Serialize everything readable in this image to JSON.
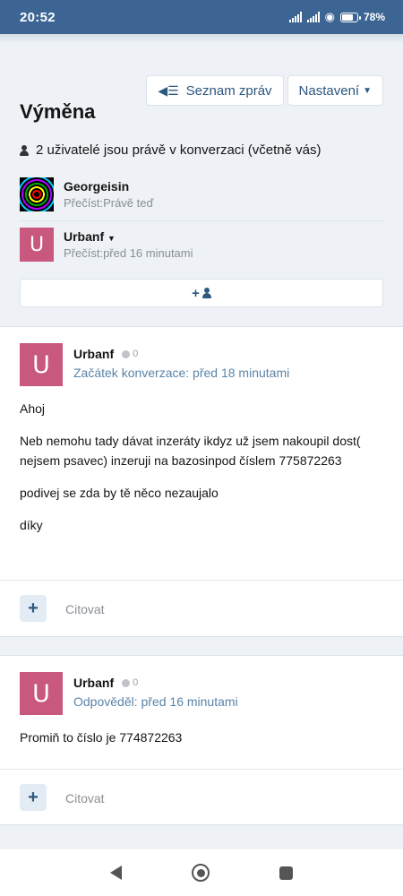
{
  "status_bar": {
    "time": "20:52",
    "battery": "78"
  },
  "toolbar": {
    "message_list": "Seznam zpráv",
    "settings": "Nastavení"
  },
  "page_title": "Výměna",
  "participants": {
    "note": "2 uživatelé jsou právě v konverzaci (včetně vás)",
    "members": [
      {
        "name": "Georgeisin",
        "read_label": "Přečíst:Právě teď"
      },
      {
        "name": "Urbanf",
        "read_label": "Přečíst:před 16 minutami",
        "avatar_letter": "U"
      }
    ]
  },
  "messages": [
    {
      "author": "Urbanf",
      "avatar_letter": "U",
      "count": "0",
      "meta": "Začátek konverzace: před 18 minutami",
      "paragraphs": [
        "Ahoj",
        "Neb nemohu tady dávat inzeráty ikdyz už jsem nakoupil dost( nejsem psavec) inzeruji na bazosinpod číslem 775872263",
        "podivej se zda by tě něco nezaujalo",
        "díky"
      ],
      "quote": "Citovat"
    },
    {
      "author": "Urbanf",
      "avatar_letter": "U",
      "count": "0",
      "meta": "Odpověděl: před 16 minutami",
      "paragraphs": [
        "Promiň to číslo je 774872263"
      ],
      "quote": "Citovat"
    }
  ],
  "colors": {
    "header": "#3c6594",
    "accent": "#2c577f",
    "avatar": "#c8587d",
    "meta": "#5a84a8"
  }
}
